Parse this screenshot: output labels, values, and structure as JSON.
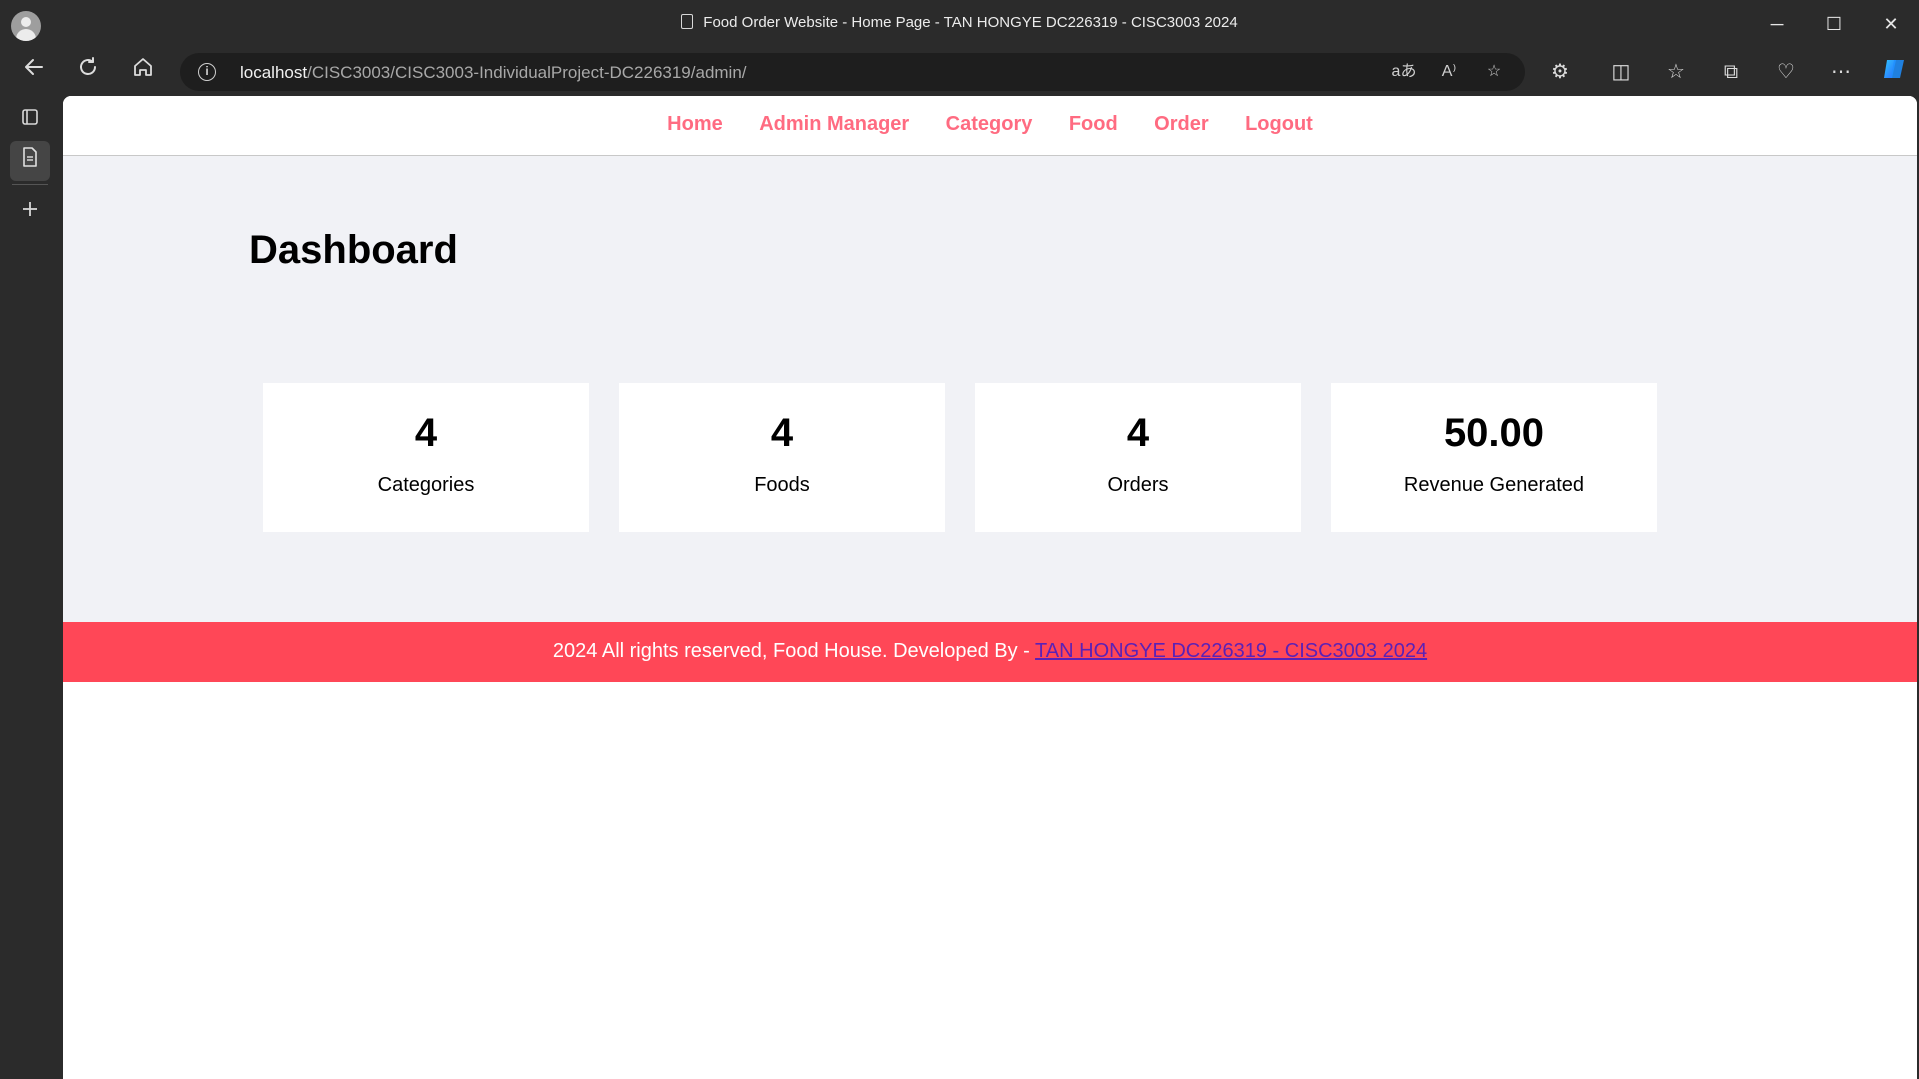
{
  "browser": {
    "window_title": "Food Order Website - Home Page - TAN HONGYE DC226319 - CISC3003 2024",
    "url_host": "localhost",
    "url_path": "/CISC3003/CISC3003-IndividualProject-DC226319/admin/",
    "controls": {
      "minimize": "─",
      "maximize": "☐",
      "close": "✕"
    },
    "icons": {
      "back": "back-arrow-icon",
      "refresh": "refresh-icon",
      "home": "home-icon",
      "info": "info-icon"
    }
  },
  "nav": {
    "items": [
      {
        "label": "Home"
      },
      {
        "label": "Admin Manager"
      },
      {
        "label": "Category"
      },
      {
        "label": "Food"
      },
      {
        "label": "Order"
      },
      {
        "label": "Logout"
      }
    ],
    "color": "#ff6b81"
  },
  "dashboard": {
    "title": "Dashboard",
    "cards": [
      {
        "value": "4",
        "label": "Categories"
      },
      {
        "value": "4",
        "label": "Foods"
      },
      {
        "value": "4",
        "label": "Orders"
      },
      {
        "value": "50.00",
        "label": "Revenue Generated"
      }
    ]
  },
  "footer": {
    "text": "2024 All rights reserved, Food House. Developed By - ",
    "link_text": "TAN HONGYE DC226319 - CISC3003 2024",
    "background": "#ff4757"
  }
}
